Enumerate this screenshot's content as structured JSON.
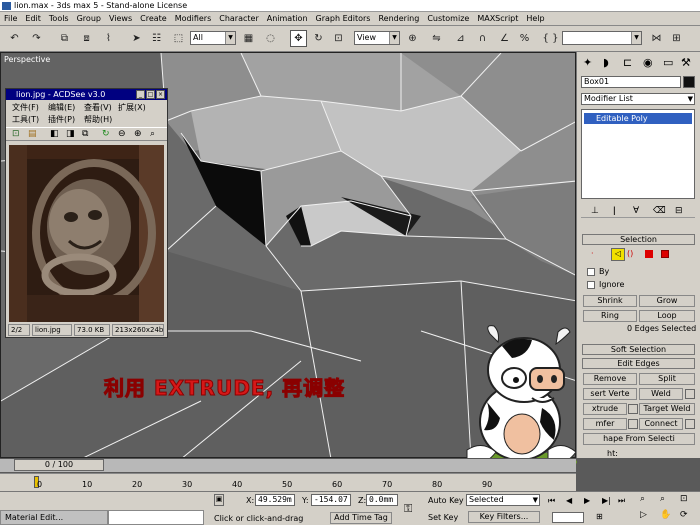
{
  "window": {
    "title": "lion.max - 3ds max 5 - Stand-alone License"
  },
  "menu": [
    "File",
    "Edit",
    "Tools",
    "Group",
    "Views",
    "Create",
    "Modifiers",
    "Character",
    "Animation",
    "Graph Editors",
    "Rendering",
    "Customize",
    "MAXScript",
    "Help"
  ],
  "toolbar": {
    "selection_filter": "All",
    "coord_system": "View"
  },
  "viewport": {
    "label": "Perspective"
  },
  "acdsee": {
    "title": "lion.jpg - ACDSee v3.0",
    "menu_row1": [
      "文件(F)",
      "编辑(E)",
      "查看(V)",
      "扩展(X)"
    ],
    "menu_row2": [
      "工具(T)",
      "插件(P)",
      "帮助(H)"
    ],
    "status": {
      "index": "2/2",
      "filename": "lion.jpg",
      "size": "73.0 KB",
      "dims": "213x260x24b i"
    }
  },
  "command_panel": {
    "object_name": "Box01",
    "modifier_list": "Modifier List",
    "stack_item": "Editable Poly",
    "selection_rollout": "Selection",
    "by_vertex": "By",
    "ignore_backfacing": "Ignore",
    "shrink": "Shrink",
    "grow": "Grow",
    "ring": "Ring",
    "loop": "Loop",
    "edges_selected": "0 Edges Selected",
    "soft_selection": "Soft Selection",
    "edit_edges": "Edit Edges",
    "remove": "Remove",
    "split": "Split",
    "insert_vertex": "sert Verte",
    "weld": "Weld",
    "extrude": "xtrude",
    "target_weld": "Target Weld",
    "chamfer": "mfer",
    "connect": "Connect",
    "shape_from_selection": "hape From Selecti",
    "weight": "ht:",
    "crease": "ase:"
  },
  "overlay_text": "利用 EXTRUDE, 再调整",
  "timeline": {
    "slider": "0 / 100",
    "ticks": [
      "0",
      "10",
      "20",
      "30",
      "40",
      "50",
      "60",
      "70",
      "80",
      "90"
    ]
  },
  "status_bar": {
    "taskbar_item": "Material Edit...",
    "x_label": "X:",
    "x_value": "49.529m",
    "y_label": "Y:",
    "y_value": "-154.07",
    "z_label": "Z:",
    "z_value": "0.0mm",
    "prompt": "Click or click-and-drag",
    "add_time_tag": "Add Time Tag",
    "auto_key": "Auto Key",
    "set_key": "Set Key",
    "selected": "Selected",
    "key_filters": "Key Filters..."
  }
}
